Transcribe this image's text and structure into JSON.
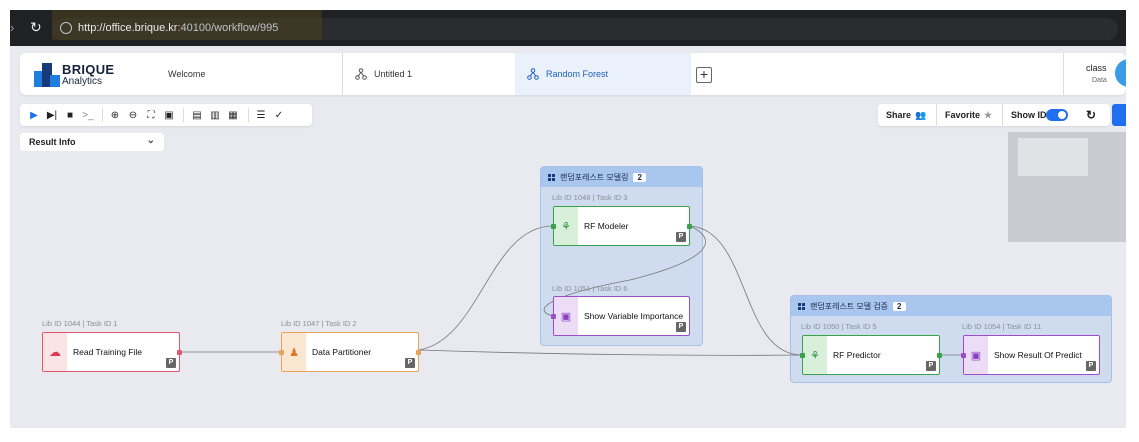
{
  "browser": {
    "url_host": "http://office.brique.kr",
    "url_path": ":40100/workflow/995"
  },
  "app": {
    "logo_main": "BRIQUE",
    "logo_sub": "Analytics"
  },
  "tabs": [
    {
      "label": "Welcome"
    },
    {
      "label": "Untitled 1"
    },
    {
      "label": "Random Forest"
    }
  ],
  "user": {
    "name": "class",
    "role": "Data"
  },
  "toolbar_right": {
    "share": "Share",
    "favorite": "Favorite",
    "show_id": "Show ID",
    "show_id_on": true
  },
  "result_info": {
    "label": "Result Info"
  },
  "groups": [
    {
      "title": "랜덤포레스트 모델링",
      "count": "2"
    },
    {
      "title": "랜덤포레스트 모델 검증",
      "count": "2"
    }
  ],
  "nodes": [
    {
      "lib": "Lib ID 1044  |  Task ID 1",
      "label": "Read Training File",
      "badge": "P"
    },
    {
      "lib": "Lib ID 1047  |  Task ID 2",
      "label": "Data Partitioner",
      "badge": "P"
    },
    {
      "lib": "Lib ID 1048  |  Task ID 3",
      "label": "RF Modeler",
      "badge": "P"
    },
    {
      "lib": "Lib ID 1051  |  Task ID 6",
      "label": "Show Variable Importance",
      "badge": "P"
    },
    {
      "lib": "Lib ID 1050  |  Task ID 5",
      "label": "RF Predictor",
      "badge": "P"
    },
    {
      "lib": "Lib ID 1054  |  Task ID 11",
      "label": "Show Result Of Predict",
      "badge": "P"
    }
  ],
  "colors": {
    "read_node": "#e0566a",
    "partition_node": "#e8a25a",
    "modeler_node": "#3aa14a",
    "show_node": "#9a4fc8",
    "accent": "#1f6ff0"
  }
}
